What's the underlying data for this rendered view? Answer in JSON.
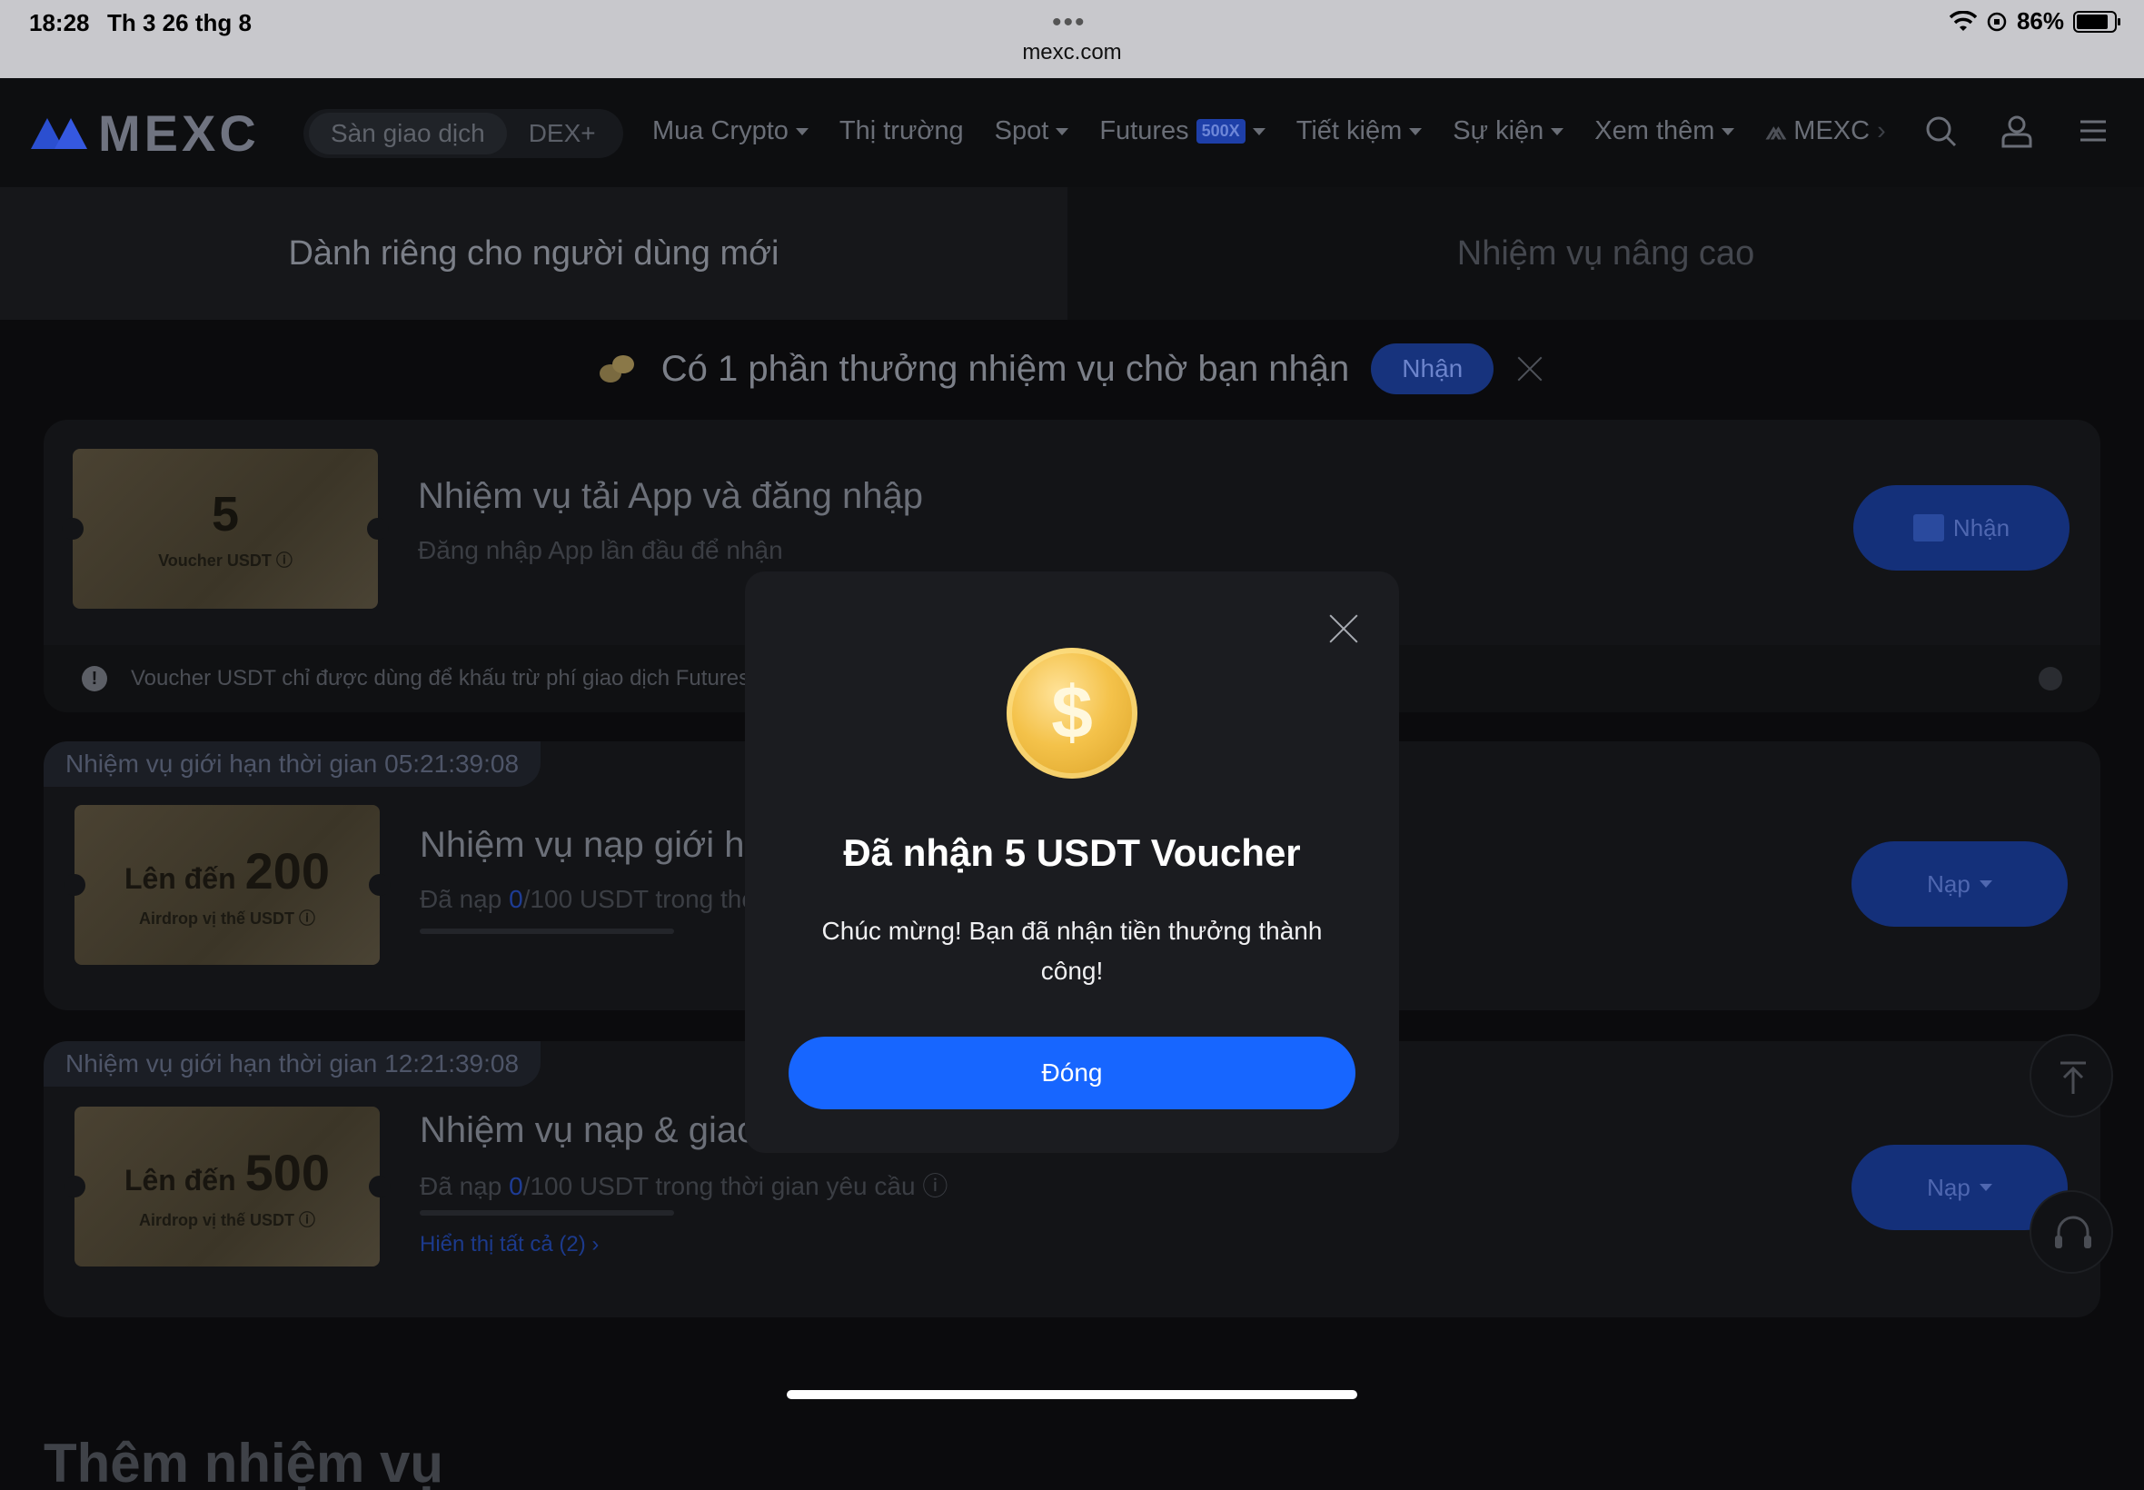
{
  "status_bar": {
    "time": "18:28",
    "date": "Th 3 26 thg 8",
    "battery": "86%",
    "url": "mexc.com"
  },
  "nav": {
    "logo": "MEXC",
    "segments": [
      "Sàn giao dịch",
      "DEX+"
    ],
    "menu": [
      "Mua Crypto",
      "Thị trường",
      "Spot",
      "Futures",
      "Tiết kiệm",
      "Sự kiện",
      "Xem thêm",
      "MEXC"
    ],
    "futures_badge": "500X"
  },
  "tabs": {
    "left": "Dành riêng cho người dùng mới",
    "right": "Nhiệm vụ nâng cao"
  },
  "reward_bar": {
    "text": "Có 1 phần thưởng nhiệm vụ chờ bạn nhận",
    "button": "Nhận"
  },
  "cards": [
    {
      "voucher_value": "5",
      "voucher_label": "Voucher USDT",
      "title": "Nhiệm vụ tải App và đăng nhập",
      "subtitle": "Đăng nhập App lần đầu để nhận",
      "button": "Nhận",
      "notice": "Voucher USDT chỉ được dùng để khấu trừ phí giao dịch Futures"
    },
    {
      "timer": "Nhiệm vụ giới hạn thời gian 05:21:39:08",
      "voucher_prefix": "Lên đến",
      "voucher_value": "200",
      "voucher_label": "Airdrop vị thế USDT",
      "title": "Nhiệm vụ nạp giới hạn thời gian",
      "subtitle_prefix": "Đã nạp",
      "subtitle_value": "0",
      "subtitle_suffix": "/100 USDT trong thời gian yêu cầu",
      "button": "Nạp"
    },
    {
      "timer": "Nhiệm vụ giới hạn thời gian 12:21:39:08",
      "voucher_prefix": "Lên đến",
      "voucher_value": "500",
      "voucher_label": "Airdrop vị thế USDT",
      "title": "Nhiệm vụ nạp & giao dịch giới hạn thời gian",
      "subtitle_prefix": "Đã nạp",
      "subtitle_value": "0",
      "subtitle_suffix": "/100 USDT trong thời gian yêu cầu",
      "show_all": "Hiển thị tất cả (2)",
      "button": "Nạp"
    }
  ],
  "more_title": "Thêm nhiệm vụ",
  "modal": {
    "title": "Đã nhận 5 USDT Voucher",
    "message": "Chúc mừng! Bạn đã nhận tiền thưởng thành công!",
    "button": "Đóng",
    "icon": "dollar-coin-icon"
  }
}
